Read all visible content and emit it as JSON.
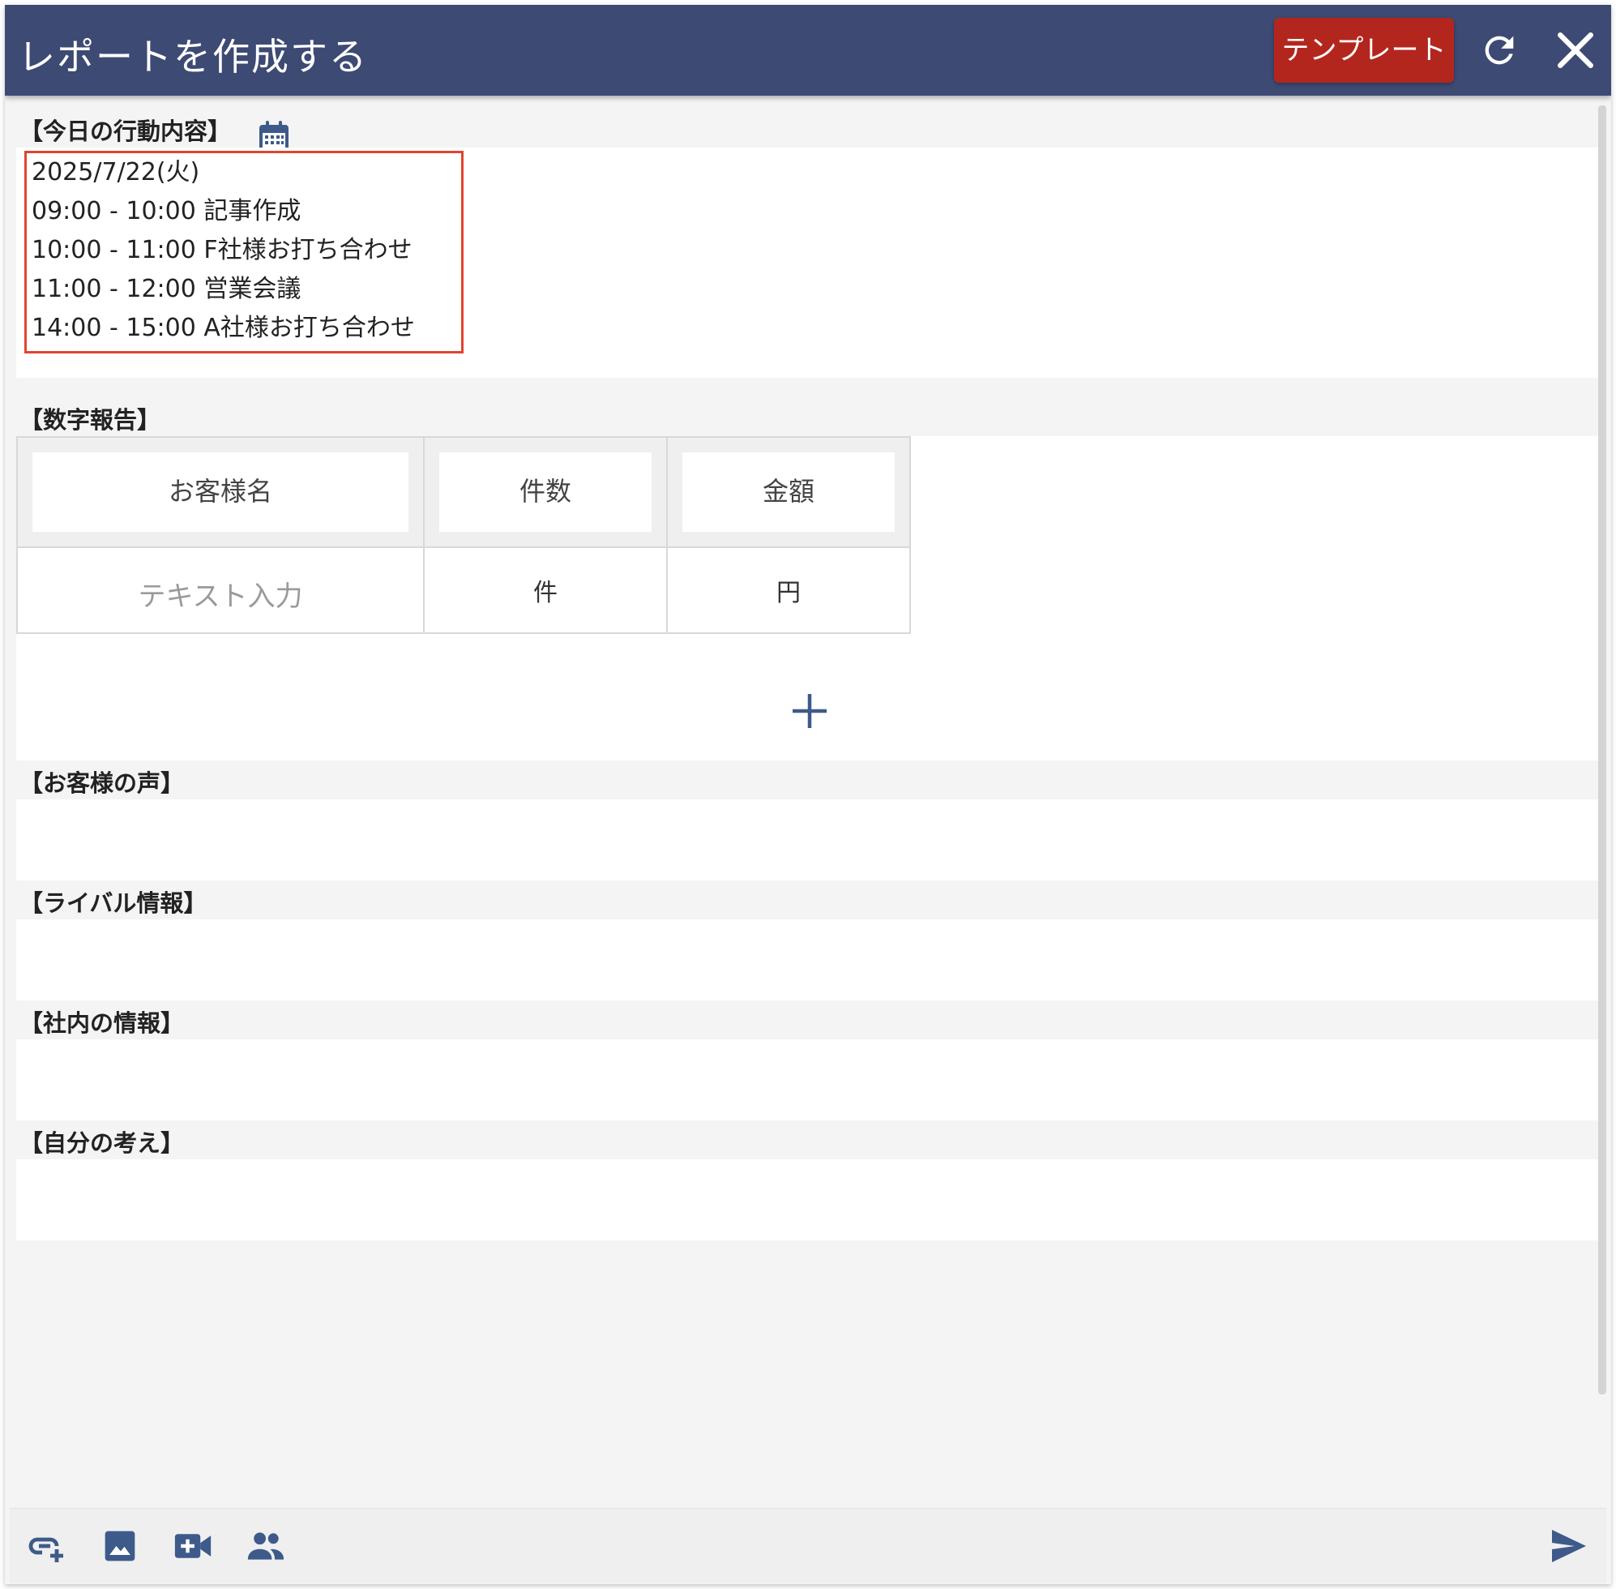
{
  "header": {
    "title": "レポートを作成する",
    "template_label": "テンプレート",
    "refresh_icon": "refresh-icon",
    "close_icon": "close-icon",
    "accent": "#3d4a73",
    "template_color": "#b3261e"
  },
  "sections": {
    "activity": {
      "label": "【今日の行動内容】",
      "calendar_icon": "calendar-icon",
      "lines": [
        "2025/7/22(火)",
        "09:00 - 10:00 記事作成",
        "10:00 - 11:00 F社様お打ち合わせ",
        "11:00 - 12:00 営業会議",
        "14:00 - 15:00 A社様お打ち合わせ"
      ]
    },
    "numbers": {
      "label": "【数字報告】",
      "headers": [
        "お客様名",
        "件数",
        "金額"
      ],
      "row": {
        "customer_placeholder": "テキスト入力",
        "count_unit": "件",
        "amount_unit": "円"
      },
      "add_icon": "plus-icon"
    },
    "customer_voice": {
      "label": "【お客様の声】"
    },
    "rival_info": {
      "label": "【ライバル情報】"
    },
    "internal_info": {
      "label": "【社内の情報】"
    },
    "own_thoughts": {
      "label": "【自分の考え】"
    }
  },
  "footer": {
    "icons": [
      "link-add-icon",
      "image-icon",
      "video-add-icon",
      "people-icon"
    ],
    "send_icon": "send-icon"
  }
}
